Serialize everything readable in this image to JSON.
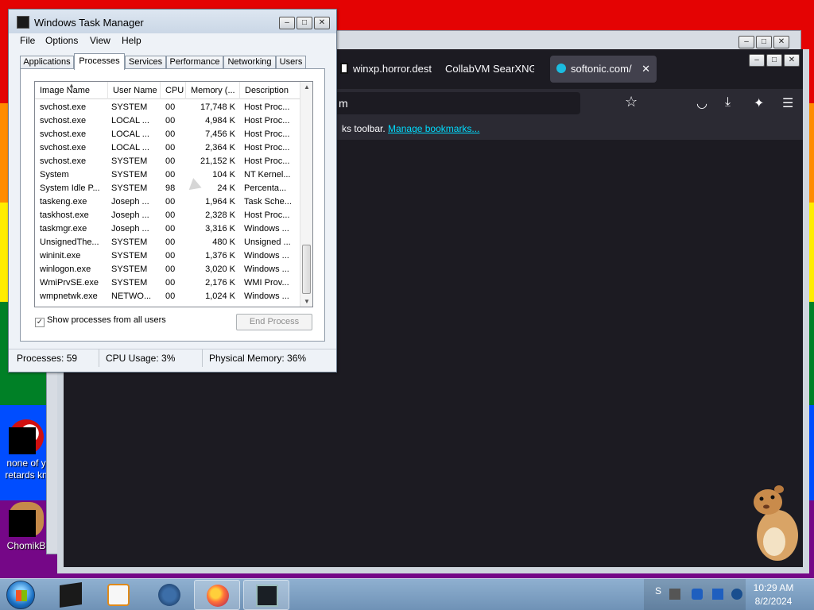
{
  "desktop": {
    "icons": [
      {
        "label": "none of y retards kn"
      },
      {
        "label": "ChomikB"
      }
    ]
  },
  "browser": {
    "tabs": [
      {
        "label": "winxp.horror.dest"
      },
      {
        "label": "CollabVM SearXNG"
      },
      {
        "label": "softonic.com/"
      }
    ],
    "tab_close": "✕",
    "url_text": "m",
    "bookmarks_text": "ks toolbar.",
    "bookmarks_link": "Manage bookmarks..."
  },
  "task_manager": {
    "title": "Windows Task Manager",
    "controls": {
      "minimize": "–",
      "maximize": "□",
      "close": "✕"
    },
    "menu": [
      "File",
      "Options",
      "View",
      "Help"
    ],
    "tabs": [
      "Applications",
      "Processes",
      "Services",
      "Performance",
      "Networking",
      "Users"
    ],
    "active_tab": "Processes",
    "columns": [
      "Image Name",
      "User Name",
      "CPU",
      "Memory (...",
      "Description"
    ],
    "rows": [
      {
        "name": "svchost.exe",
        "user": "SYSTEM",
        "cpu": "00",
        "mem": "17,748 K",
        "desc": "Host Proc..."
      },
      {
        "name": "svchost.exe",
        "user": "LOCAL ...",
        "cpu": "00",
        "mem": "4,984 K",
        "desc": "Host Proc..."
      },
      {
        "name": "svchost.exe",
        "user": "LOCAL ...",
        "cpu": "00",
        "mem": "7,456 K",
        "desc": "Host Proc..."
      },
      {
        "name": "svchost.exe",
        "user": "LOCAL ...",
        "cpu": "00",
        "mem": "2,364 K",
        "desc": "Host Proc..."
      },
      {
        "name": "svchost.exe",
        "user": "SYSTEM",
        "cpu": "00",
        "mem": "21,152 K",
        "desc": "Host Proc..."
      },
      {
        "name": "System",
        "user": "SYSTEM",
        "cpu": "00",
        "mem": "104 K",
        "desc": "NT Kernel..."
      },
      {
        "name": "System Idle P...",
        "user": "SYSTEM",
        "cpu": "98",
        "mem": "24 K",
        "desc": "Percenta..."
      },
      {
        "name": "taskeng.exe",
        "user": "Joseph ...",
        "cpu": "00",
        "mem": "1,964 K",
        "desc": "Task Sche..."
      },
      {
        "name": "taskhost.exe",
        "user": "Joseph ...",
        "cpu": "00",
        "mem": "2,328 K",
        "desc": "Host Proc..."
      },
      {
        "name": "taskmgr.exe",
        "user": "Joseph ...",
        "cpu": "00",
        "mem": "3,316 K",
        "desc": "Windows ..."
      },
      {
        "name": "UnsignedThe...",
        "user": "SYSTEM",
        "cpu": "00",
        "mem": "480 K",
        "desc": "Unsigned ..."
      },
      {
        "name": "wininit.exe",
        "user": "SYSTEM",
        "cpu": "00",
        "mem": "1,376 K",
        "desc": "Windows ..."
      },
      {
        "name": "winlogon.exe",
        "user": "SYSTEM",
        "cpu": "00",
        "mem": "3,020 K",
        "desc": "Windows ..."
      },
      {
        "name": "WmiPrvSE.exe",
        "user": "SYSTEM",
        "cpu": "00",
        "mem": "2,176 K",
        "desc": "WMI Prov..."
      },
      {
        "name": "wmpnetwk.exe",
        "user": "NETWO...",
        "cpu": "00",
        "mem": "1,024 K",
        "desc": "Windows ..."
      }
    ],
    "show_all_label": "Show processes from all users",
    "show_all_checked": true,
    "end_process_label": "End Process",
    "status": {
      "processes": "Processes: 59",
      "cpu": "CPU Usage: 3%",
      "memory": "Physical Memory: 36%"
    }
  },
  "taskbar": {
    "apps": [
      "cmd-icon",
      "media-player-icon",
      "ie-icon",
      "firefox-icon",
      "task-manager-icon"
    ],
    "tray_letter": "S",
    "clock_time": "10:29 AM",
    "clock_date": "8/2/2024"
  }
}
